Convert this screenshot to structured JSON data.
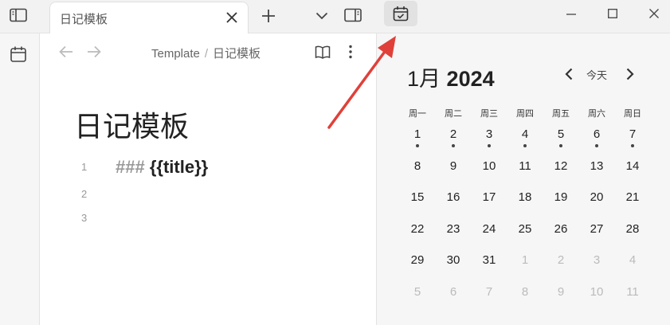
{
  "tab": {
    "title": "日记模板"
  },
  "breadcrumb": {
    "folder": "Template",
    "separator": "/",
    "file": "日记模板"
  },
  "document": {
    "title": "日记模板",
    "lines": [
      {
        "number": "1",
        "hash": "###",
        "text": "{{title}}"
      },
      {
        "number": "2"
      },
      {
        "number": "3"
      }
    ]
  },
  "calendar": {
    "month": "1月",
    "year": "2024",
    "today_label": "今天",
    "weekdays": [
      "周一",
      "周二",
      "周三",
      "周四",
      "周五",
      "周六",
      "周日"
    ],
    "weeks": [
      [
        "1",
        "2",
        "3",
        "4",
        "5",
        "6",
        "7"
      ],
      [
        "8",
        "9",
        "10",
        "11",
        "12",
        "13",
        "14"
      ],
      [
        "15",
        "16",
        "17",
        "18",
        "19",
        "20",
        "21"
      ],
      [
        "22",
        "23",
        "24",
        "25",
        "26",
        "27",
        "28"
      ],
      [
        "29",
        "30",
        "31",
        "1",
        "2",
        "3",
        "4"
      ],
      [
        "5",
        "6",
        "7",
        "8",
        "9",
        "10",
        "11"
      ]
    ]
  },
  "colors": {
    "arrow": "#e0403a",
    "accent": "#333333"
  },
  "icons": [
    "sidebar-toggle-icon",
    "calendar-icon",
    "close-icon",
    "plus-icon",
    "chevron-down-icon",
    "right-sidebar-icon",
    "arrow-left-icon",
    "arrow-right-icon",
    "book-icon",
    "more-vertical-icon",
    "calendar-check-icon",
    "minimize-icon",
    "maximize-icon",
    "window-close-icon",
    "chevron-left-icon",
    "chevron-right-icon"
  ]
}
